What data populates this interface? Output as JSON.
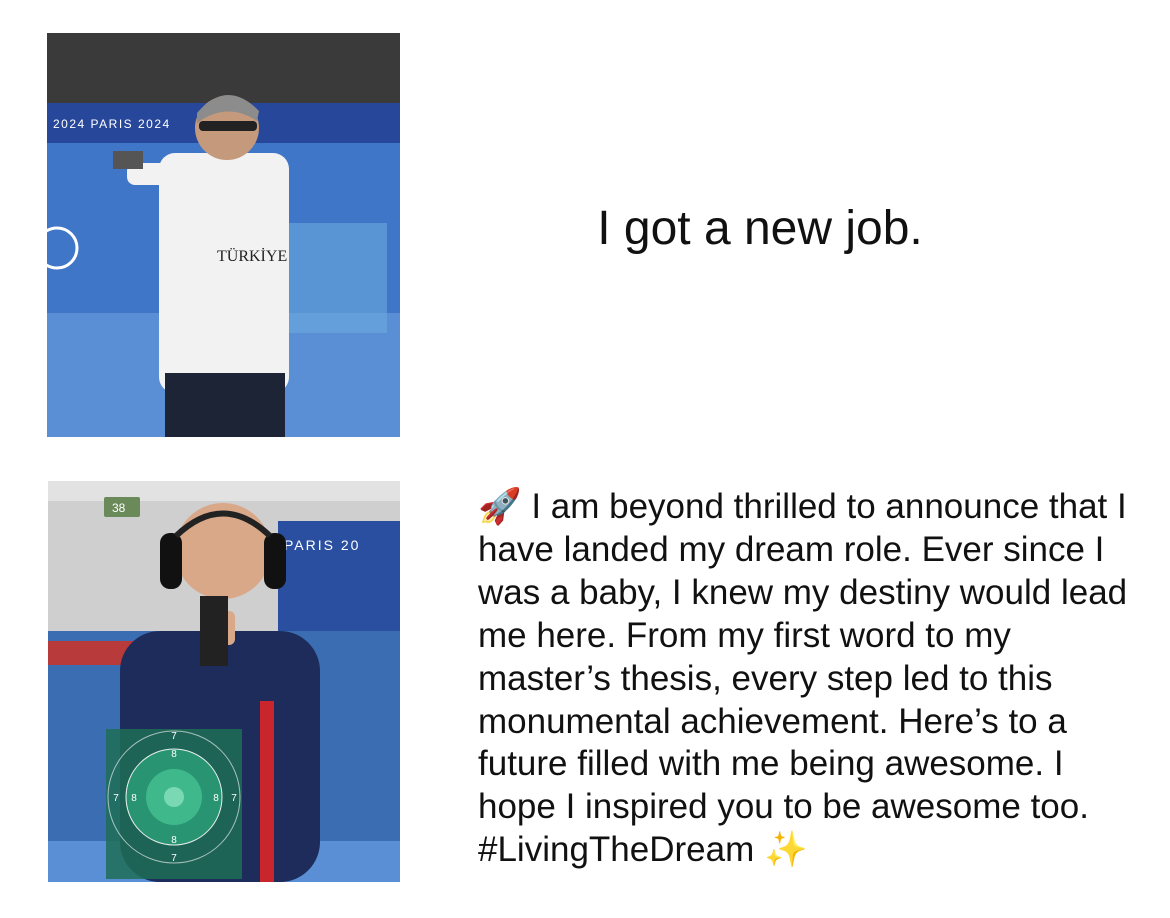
{
  "panels": {
    "top": {
      "banner_text": "2024 PARIS 2024",
      "shirt_text": "TÜRKİYE",
      "caption": "I got a new job."
    },
    "bottom": {
      "lane_number": "38",
      "banner_text": "PARIS 20",
      "target_rings": {
        "top": "7",
        "inner_top": "8",
        "left_outer": "7",
        "left_inner": "8",
        "right_inner": "8",
        "right_outer": "7",
        "inner_bottom": "8",
        "bottom": "7"
      },
      "post": {
        "start_icon": "rocket-icon",
        "text": "I am beyond thrilled to announce that I have landed my dream role. Ever since I was a baby, I knew my destiny would lead me here. From my first word to my master’s thesis, every step led to this monumental achievement. Here’s to a future filled with me being awesome. I hope I inspired you to be awesome too. #LivingTheDream",
        "end_icon": "sparkles-icon"
      }
    }
  }
}
